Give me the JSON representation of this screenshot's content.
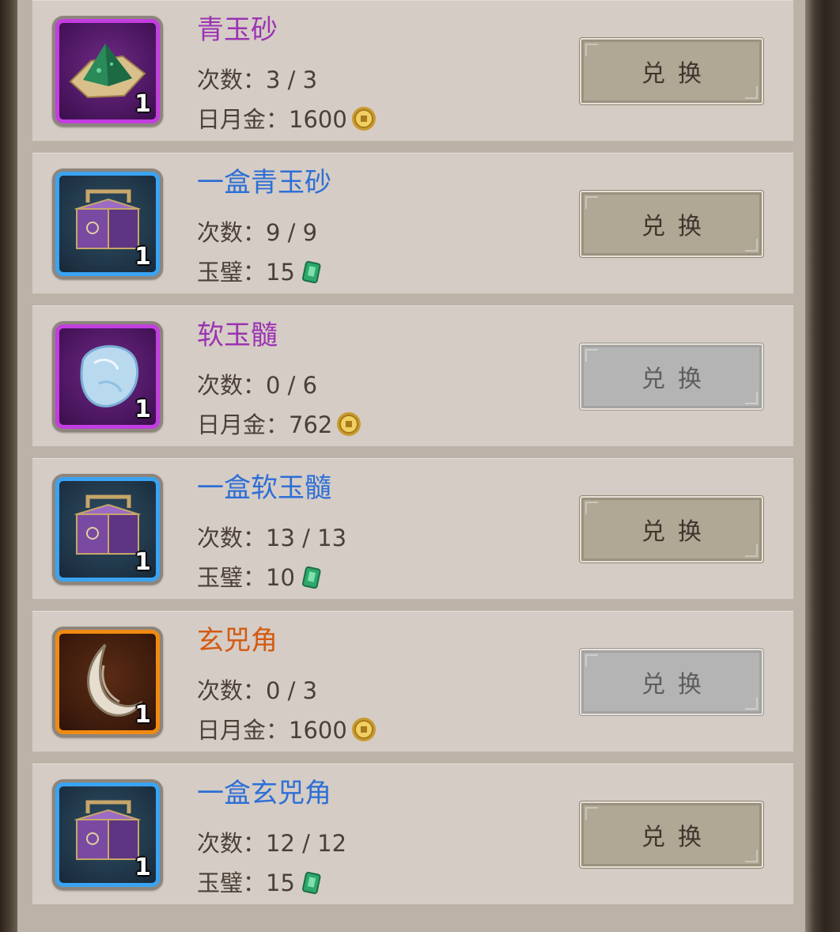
{
  "exchange_list": {
    "count_label": "次数：",
    "items": [
      {
        "name": "青玉砂",
        "quality": "purple",
        "icon": "green-sand-pile-icon",
        "quantity": "1",
        "count": "3 / 3",
        "currency_label": "日月金：",
        "price": "1600",
        "currency_icon": "gold-coin-icon",
        "button_label": "兑换",
        "button_enabled": true
      },
      {
        "name": "一盒青玉砂",
        "quality": "blue",
        "icon": "purple-chest-icon",
        "quantity": "1",
        "count": "9 / 9",
        "currency_label": "玉璧：",
        "price": "15",
        "currency_icon": "jade-bi-icon",
        "button_label": "兑换",
        "button_enabled": true
      },
      {
        "name": "软玉髓",
        "quality": "purple",
        "icon": "soft-jade-stone-icon",
        "quantity": "1",
        "count": "0 / 6",
        "currency_label": "日月金：",
        "price": "762",
        "currency_icon": "gold-coin-icon",
        "button_label": "兑换",
        "button_enabled": false
      },
      {
        "name": "一盒软玉髓",
        "quality": "blue",
        "icon": "purple-chest-icon",
        "quantity": "1",
        "count": "13 / 13",
        "currency_label": "玉璧：",
        "price": "10",
        "currency_icon": "jade-bi-icon",
        "button_label": "兑换",
        "button_enabled": true
      },
      {
        "name": "玄兕角",
        "quality": "orange",
        "icon": "curved-horn-icon",
        "quantity": "1",
        "count": "0 / 3",
        "currency_label": "日月金：",
        "price": "1600",
        "currency_icon": "gold-coin-icon",
        "button_label": "兑换",
        "button_enabled": false
      },
      {
        "name": "一盒玄兕角",
        "quality": "blue",
        "icon": "purple-chest-icon",
        "quantity": "1",
        "count": "12 / 12",
        "currency_label": "玉璧：",
        "price": "15",
        "currency_icon": "jade-bi-icon",
        "button_label": "兑换",
        "button_enabled": true
      }
    ]
  },
  "colors": {
    "purple_quality": "#c23ee0",
    "blue_quality": "#3aa3f2",
    "orange_quality": "#f08a12",
    "purple_name": "#9b33b3",
    "blue_name": "#2d6fd6",
    "orange_name": "#d35a11"
  }
}
